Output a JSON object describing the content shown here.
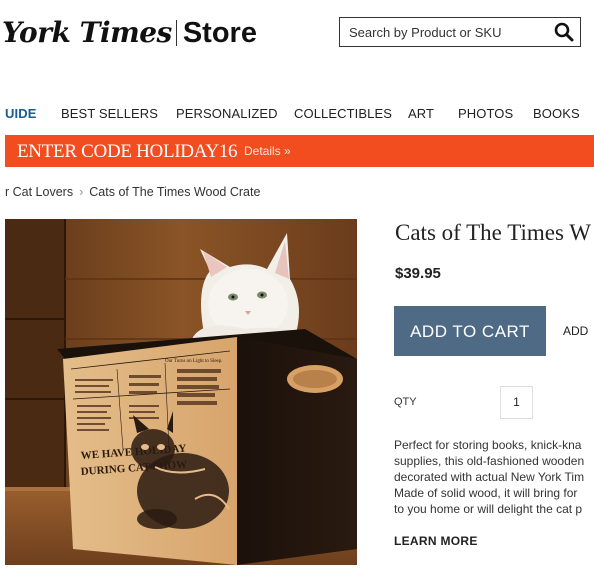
{
  "header": {
    "logo_text": "York Times",
    "logo_store": "Store",
    "search_placeholder": "Search by Product or SKU"
  },
  "nav": {
    "items": [
      {
        "label": "UIDE"
      },
      {
        "label": "BEST SELLERS"
      },
      {
        "label": "PERSONALIZED"
      },
      {
        "label": "COLLECTIBLES"
      },
      {
        "label": "ART"
      },
      {
        "label": "PHOTOS"
      },
      {
        "label": "BOOKS"
      }
    ]
  },
  "promo": {
    "code_text": "ENTER CODE HOLIDAY16",
    "details_label": "Details »"
  },
  "breadcrumb": {
    "items": [
      "r Cat Lovers",
      "Cats of The Times Wood Crate"
    ]
  },
  "product": {
    "title": "Cats of The Times W",
    "price": "$39.95",
    "add_to_cart_label": "ADD TO CART",
    "secondary_label": "ADD",
    "qty_label": "QTY",
    "qty_value": "1",
    "description_lines": [
      "Perfect for storing books, knick-kna",
      "supplies, this old-fashioned wooden",
      "decorated with actual New York Tim",
      "Made of solid wood, it will bring for",
      "to you home or will delight the cat p"
    ],
    "learn_more_label": "LEARN MORE"
  },
  "image": {
    "crate_header": "Our Turns on Light to Sleep.",
    "crate_big_text_1": "WE HAVE HOLIDAY",
    "crate_big_text_2": "DURING CAT SHOW",
    "crate_col_1": "CAT THAT TALKS ASKS FOR MILK",
    "crate_col_2": "Jersey Cat Walks 210 Miles Back Home From Up-State"
  }
}
